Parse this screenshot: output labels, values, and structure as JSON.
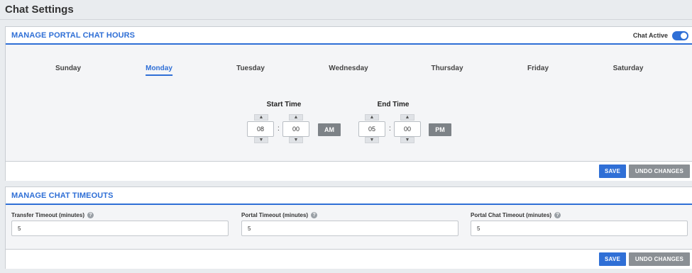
{
  "page": {
    "title": "Chat Settings"
  },
  "hours_panel": {
    "title": "MANAGE PORTAL CHAT HOURS",
    "chat_active_label": "Chat Active",
    "chat_active": true,
    "days": [
      "Sunday",
      "Monday",
      "Tuesday",
      "Wednesday",
      "Thursday",
      "Friday",
      "Saturday"
    ],
    "selected_day": "Monday",
    "start_time": {
      "label": "Start Time",
      "hour": "08",
      "minute": "00",
      "ampm": "AM"
    },
    "end_time": {
      "label": "End Time",
      "hour": "05",
      "minute": "00",
      "ampm": "PM"
    },
    "colon": ":",
    "save_label": "SAVE",
    "undo_label": "UNDO CHANGES"
  },
  "timeouts_panel": {
    "title": "MANAGE CHAT TIMEOUTS",
    "fields": [
      {
        "label": "Transfer Timeout (minutes)",
        "value": "5"
      },
      {
        "label": "Portal Timeout (minutes)",
        "value": "5"
      },
      {
        "label": "Portal Chat Timeout (minutes)",
        "value": "5"
      }
    ],
    "help_glyph": "?",
    "save_label": "SAVE",
    "undo_label": "UNDO CHANGES"
  },
  "icons": {
    "up": "chevron-up-icon",
    "down": "chevron-down-icon",
    "help": "question-circle-icon"
  },
  "colors": {
    "accent": "#2f6fd6",
    "ampm_button": "#7d8287",
    "undo_button": "#8a8f94"
  }
}
